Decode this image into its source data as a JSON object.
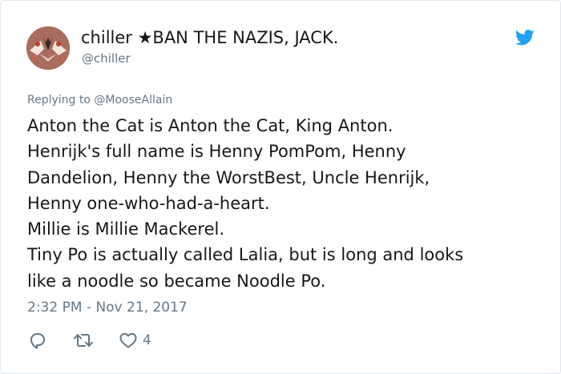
{
  "tweet": {
    "display_name": "chiller ★BAN THE NAZIS, JACK.",
    "handle": "@chiller",
    "replying_prefix": "Replying to ",
    "replying_to": "@MooseAllain",
    "lines": [
      "Anton the Cat is Anton the Cat, King Anton.",
      "Henrijk's full name is Henny PomPom, Henny",
      "Dandelion, Henny the WorstBest, Uncle Henrijk,",
      "Henny one-who-had-a-heart.",
      "Millie is Millie Mackerel.",
      "Tiny Po is actually called Lalia, but is long and looks",
      "like a noodle so became Noodle Po."
    ],
    "timestamp": "2:32 PM - Nov 21, 2017",
    "like_count": "4"
  },
  "colors": {
    "twitter_blue": "#1da1f2",
    "muted_text": "#657786",
    "main_text": "#14171a"
  },
  "icons": [
    "twitter-bird-icon",
    "reply-icon",
    "retweet-icon",
    "heart-icon"
  ]
}
